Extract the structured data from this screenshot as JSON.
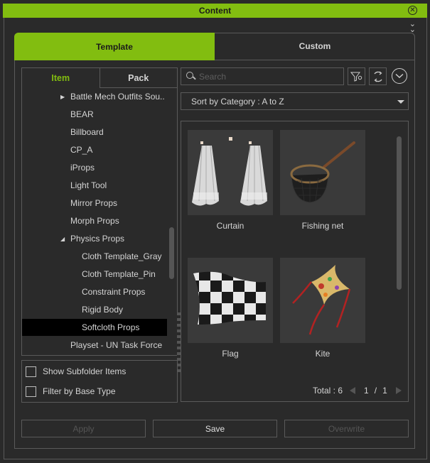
{
  "window": {
    "title": "Content",
    "close_icon": "circle-x-icon",
    "collapse_icon": "double-chevron-down-icon"
  },
  "tabs": [
    {
      "label": "Template",
      "active": true
    },
    {
      "label": "Custom",
      "active": false
    }
  ],
  "left_panel": {
    "subtabs": [
      {
        "label": "Item",
        "active": true
      },
      {
        "label": "Pack",
        "active": false
      }
    ],
    "tree": [
      {
        "label": "Battle Mech Outfits Sou..",
        "level": 0,
        "arrow": "collapsed"
      },
      {
        "label": "BEAR",
        "level": 0
      },
      {
        "label": "Billboard",
        "level": 0
      },
      {
        "label": "CP_A",
        "level": 0
      },
      {
        "label": "iProps",
        "level": 0
      },
      {
        "label": "Light Tool",
        "level": 0
      },
      {
        "label": "Mirror Props",
        "level": 0
      },
      {
        "label": "Morph Props",
        "level": 0
      },
      {
        "label": "Physics Props",
        "level": 0,
        "arrow": "expanded"
      },
      {
        "label": "Cloth Template_Gray",
        "level": 1
      },
      {
        "label": "Cloth Template_Pin",
        "level": 1
      },
      {
        "label": "Constraint Props",
        "level": 1
      },
      {
        "label": "Rigid Body",
        "level": 1
      },
      {
        "label": "Softcloth Props",
        "level": 1,
        "selected": true
      },
      {
        "label": "Playset - UN Task Force",
        "level": 0
      }
    ],
    "options": [
      {
        "label": "Show Subfolder Items",
        "checked": false
      },
      {
        "label": "Filter by Base Type",
        "checked": false
      }
    ]
  },
  "right_panel": {
    "search": {
      "placeholder": "Search",
      "value": ""
    },
    "toolbar_icons": [
      "filter-settings-icon",
      "refresh-icon",
      "circle-chevron-down-icon"
    ],
    "sort": {
      "selected": "Sort by Category : A to Z"
    },
    "items": [
      {
        "label": "Curtain",
        "thumb": "curtain"
      },
      {
        "label": "Fishing net",
        "thumb": "fishing-net"
      },
      {
        "label": "Flag",
        "thumb": "flag"
      },
      {
        "label": "Kite",
        "thumb": "kite"
      }
    ],
    "footer": {
      "total_label": "Total : 6",
      "page": "1",
      "separator": "/",
      "pages": "1"
    }
  },
  "buttons": [
    {
      "label": "Apply",
      "enabled": false
    },
    {
      "label": "Save",
      "enabled": true
    },
    {
      "label": "Overwrite",
      "enabled": false
    }
  ],
  "colors": {
    "accent": "#82bd10",
    "background": "#2a2a2a",
    "border": "#5a5a5a",
    "selected_row": "#000000"
  }
}
